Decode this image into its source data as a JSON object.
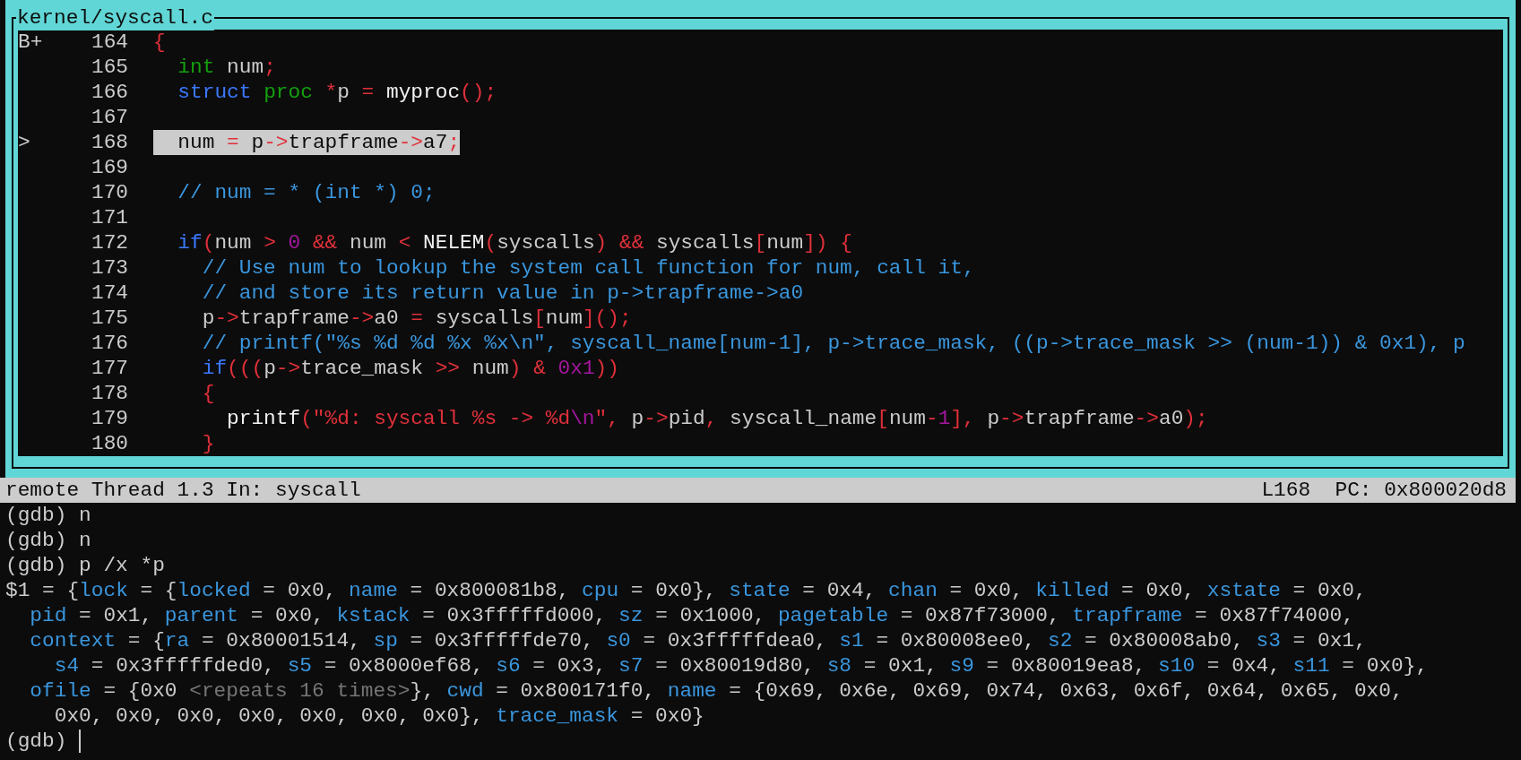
{
  "source_window": {
    "title": "kernel/syscall.c",
    "lines": [
      {
        "marker": "B+",
        "number": "164",
        "current": false,
        "tokens": [
          {
            "kind": "op",
            "text": "{"
          }
        ]
      },
      {
        "number": "165",
        "current": false,
        "tokens": [
          {
            "kind": "type",
            "text": "  int"
          },
          {
            "kind": "plain",
            "text": " num"
          },
          {
            "kind": "op",
            "text": ";"
          }
        ]
      },
      {
        "number": "166",
        "current": false,
        "tokens": [
          {
            "kind": "keyword",
            "text": "  struct"
          },
          {
            "kind": "type",
            "text": " proc"
          },
          {
            "kind": "op",
            "text": " *"
          },
          {
            "kind": "plain",
            "text": "p "
          },
          {
            "kind": "op",
            "text": "="
          },
          {
            "kind": "func",
            "text": " myproc"
          },
          {
            "kind": "op",
            "text": "();"
          }
        ]
      },
      {
        "number": "167",
        "current": false
      },
      {
        "marker": ">",
        "number": "168",
        "current": true,
        "tokens": [
          {
            "kind": "plain",
            "text": "  num "
          },
          {
            "kind": "op",
            "text": "="
          },
          {
            "kind": "plain",
            "text": " p"
          },
          {
            "kind": "op",
            "text": "->"
          },
          {
            "kind": "plain",
            "text": "trapframe"
          },
          {
            "kind": "op",
            "text": "->"
          },
          {
            "kind": "plain",
            "text": "a7"
          },
          {
            "kind": "op",
            "text": ";"
          }
        ]
      },
      {
        "number": "169",
        "current": false
      },
      {
        "number": "170",
        "current": false,
        "tokens": [
          {
            "kind": "comment",
            "text": "  // num = * (int *) 0;"
          }
        ]
      },
      {
        "number": "171",
        "current": false
      },
      {
        "number": "172",
        "current": false,
        "tokens": [
          {
            "kind": "keyword",
            "text": "  if"
          },
          {
            "kind": "op",
            "text": "("
          },
          {
            "kind": "plain",
            "text": "num "
          },
          {
            "kind": "op",
            "text": ">"
          },
          {
            "kind": "number",
            "text": " 0"
          },
          {
            "kind": "op",
            "text": " &&"
          },
          {
            "kind": "plain",
            "text": " num "
          },
          {
            "kind": "op",
            "text": "<"
          },
          {
            "kind": "func",
            "text": " NELEM"
          },
          {
            "kind": "op",
            "text": "("
          },
          {
            "kind": "plain",
            "text": "syscalls"
          },
          {
            "kind": "op",
            "text": ")"
          },
          {
            "kind": "op",
            "text": " &&"
          },
          {
            "kind": "plain",
            "text": " syscalls"
          },
          {
            "kind": "op",
            "text": "["
          },
          {
            "kind": "plain",
            "text": "num"
          },
          {
            "kind": "op",
            "text": "])"
          },
          {
            "kind": "op",
            "text": " {"
          }
        ]
      },
      {
        "number": "173",
        "current": false,
        "tokens": [
          {
            "kind": "comment",
            "text": "    // Use num to lookup the system call function for num, call it,"
          }
        ]
      },
      {
        "number": "174",
        "current": false,
        "tokens": [
          {
            "kind": "comment",
            "text": "    // and store its return value in p->trapframe->a0"
          }
        ]
      },
      {
        "number": "175",
        "current": false,
        "tokens": [
          {
            "kind": "plain",
            "text": "    p"
          },
          {
            "kind": "op",
            "text": "->"
          },
          {
            "kind": "plain",
            "text": "trapframe"
          },
          {
            "kind": "op",
            "text": "->"
          },
          {
            "kind": "plain",
            "text": "a0 "
          },
          {
            "kind": "op",
            "text": "="
          },
          {
            "kind": "plain",
            "text": " syscalls"
          },
          {
            "kind": "op",
            "text": "["
          },
          {
            "kind": "plain",
            "text": "num"
          },
          {
            "kind": "op",
            "text": "]();"
          }
        ]
      },
      {
        "number": "176",
        "current": false,
        "tokens": [
          {
            "kind": "comment",
            "text": "    // printf(\"%s %d %d %x %x\\n\", syscall_name[num-1], p->trace_mask, ((p->trace_mask >> (num-1)) & 0x1), p"
          }
        ]
      },
      {
        "number": "177",
        "current": false,
        "tokens": [
          {
            "kind": "keyword",
            "text": "    if"
          },
          {
            "kind": "op",
            "text": "((("
          },
          {
            "kind": "plain",
            "text": "p"
          },
          {
            "kind": "op",
            "text": "->"
          },
          {
            "kind": "plain",
            "text": "trace_mask "
          },
          {
            "kind": "op",
            "text": ">>"
          },
          {
            "kind": "plain",
            "text": " num"
          },
          {
            "kind": "op",
            "text": ")"
          },
          {
            "kind": "op",
            "text": " &"
          },
          {
            "kind": "number",
            "text": " 0x1"
          },
          {
            "kind": "op",
            "text": "))"
          }
        ]
      },
      {
        "number": "178",
        "current": false,
        "tokens": [
          {
            "kind": "op",
            "text": "    {"
          }
        ]
      },
      {
        "number": "179",
        "current": false,
        "tokens": [
          {
            "kind": "func",
            "text": "      printf"
          },
          {
            "kind": "op",
            "text": "("
          },
          {
            "kind": "string",
            "text": "\"%d: syscall %s -> %d"
          },
          {
            "kind": "number",
            "text": "\\n"
          },
          {
            "kind": "string",
            "text": "\""
          },
          {
            "kind": "op",
            "text": ","
          },
          {
            "kind": "plain",
            "text": " p"
          },
          {
            "kind": "op",
            "text": "->"
          },
          {
            "kind": "plain",
            "text": "pid"
          },
          {
            "kind": "op",
            "text": ","
          },
          {
            "kind": "plain",
            "text": " syscall_name"
          },
          {
            "kind": "op",
            "text": "["
          },
          {
            "kind": "plain",
            "text": "num"
          },
          {
            "kind": "op",
            "text": "-"
          },
          {
            "kind": "number",
            "text": "1"
          },
          {
            "kind": "op",
            "text": "],"
          },
          {
            "kind": "plain",
            "text": " p"
          },
          {
            "kind": "op",
            "text": "->"
          },
          {
            "kind": "plain",
            "text": "trapframe"
          },
          {
            "kind": "op",
            "text": "->"
          },
          {
            "kind": "plain",
            "text": "a0"
          },
          {
            "kind": "op",
            "text": ");"
          }
        ]
      },
      {
        "number": "180",
        "current": false,
        "tokens": [
          {
            "kind": "op",
            "text": "    }"
          }
        ]
      }
    ]
  },
  "status_bar": {
    "left": "remote Thread 1.3 In: syscall",
    "right": "L168  PC: 0x800020d8"
  },
  "console": {
    "lines": [
      [
        {
          "kind": "plain",
          "text": "(gdb) n"
        }
      ],
      [
        {
          "kind": "plain",
          "text": "(gdb) n"
        }
      ],
      [
        {
          "kind": "plain",
          "text": "(gdb) p /x *p"
        }
      ],
      [
        {
          "kind": "plain",
          "text": "$1 = {"
        },
        {
          "kind": "field",
          "text": "lock"
        },
        {
          "kind": "plain",
          "text": " = {"
        },
        {
          "kind": "field",
          "text": "locked"
        },
        {
          "kind": "plain",
          "text": " = 0x0, "
        },
        {
          "kind": "field",
          "text": "name"
        },
        {
          "kind": "plain",
          "text": " = 0x800081b8, "
        },
        {
          "kind": "field",
          "text": "cpu"
        },
        {
          "kind": "plain",
          "text": " = 0x0}, "
        },
        {
          "kind": "field",
          "text": "state"
        },
        {
          "kind": "plain",
          "text": " = 0x4, "
        },
        {
          "kind": "field",
          "text": "chan"
        },
        {
          "kind": "plain",
          "text": " = 0x0, "
        },
        {
          "kind": "field",
          "text": "killed"
        },
        {
          "kind": "plain",
          "text": " = 0x0, "
        },
        {
          "kind": "field",
          "text": "xstate"
        },
        {
          "kind": "plain",
          "text": " = 0x0,"
        }
      ],
      [
        {
          "kind": "field",
          "text": "  pid"
        },
        {
          "kind": "plain",
          "text": " = 0x1, "
        },
        {
          "kind": "field",
          "text": "parent"
        },
        {
          "kind": "plain",
          "text": " = 0x0, "
        },
        {
          "kind": "field",
          "text": "kstack"
        },
        {
          "kind": "plain",
          "text": " = 0x3fffffd000, "
        },
        {
          "kind": "field",
          "text": "sz"
        },
        {
          "kind": "plain",
          "text": " = 0x1000, "
        },
        {
          "kind": "field",
          "text": "pagetable"
        },
        {
          "kind": "plain",
          "text": " = 0x87f73000, "
        },
        {
          "kind": "field",
          "text": "trapframe"
        },
        {
          "kind": "plain",
          "text": " = 0x87f74000,"
        }
      ],
      [
        {
          "kind": "field",
          "text": "  context"
        },
        {
          "kind": "plain",
          "text": " = {"
        },
        {
          "kind": "field",
          "text": "ra"
        },
        {
          "kind": "plain",
          "text": " = 0x80001514, "
        },
        {
          "kind": "field",
          "text": "sp"
        },
        {
          "kind": "plain",
          "text": " = 0x3fffffde70, "
        },
        {
          "kind": "field",
          "text": "s0"
        },
        {
          "kind": "plain",
          "text": " = 0x3fffffdea0, "
        },
        {
          "kind": "field",
          "text": "s1"
        },
        {
          "kind": "plain",
          "text": " = 0x80008ee0, "
        },
        {
          "kind": "field",
          "text": "s2"
        },
        {
          "kind": "plain",
          "text": " = 0x80008ab0, "
        },
        {
          "kind": "field",
          "text": "s3"
        },
        {
          "kind": "plain",
          "text": " = 0x1,"
        }
      ],
      [
        {
          "kind": "field",
          "text": "    s4"
        },
        {
          "kind": "plain",
          "text": " = 0x3fffffded0, "
        },
        {
          "kind": "field",
          "text": "s5"
        },
        {
          "kind": "plain",
          "text": " = 0x8000ef68, "
        },
        {
          "kind": "field",
          "text": "s6"
        },
        {
          "kind": "plain",
          "text": " = 0x3, "
        },
        {
          "kind": "field",
          "text": "s7"
        },
        {
          "kind": "plain",
          "text": " = 0x80019d80, "
        },
        {
          "kind": "field",
          "text": "s8"
        },
        {
          "kind": "plain",
          "text": " = 0x1, "
        },
        {
          "kind": "field",
          "text": "s9"
        },
        {
          "kind": "plain",
          "text": " = 0x80019ea8, "
        },
        {
          "kind": "field",
          "text": "s10"
        },
        {
          "kind": "plain",
          "text": " = 0x4, "
        },
        {
          "kind": "field",
          "text": "s11"
        },
        {
          "kind": "plain",
          "text": " = 0x0},"
        }
      ],
      [
        {
          "kind": "field",
          "text": "  ofile"
        },
        {
          "kind": "plain",
          "text": " = {0x0 "
        },
        {
          "kind": "dim",
          "text": "<repeats 16 times>"
        },
        {
          "kind": "plain",
          "text": "}, "
        },
        {
          "kind": "field",
          "text": "cwd"
        },
        {
          "kind": "plain",
          "text": " = 0x800171f0, "
        },
        {
          "kind": "field",
          "text": "name"
        },
        {
          "kind": "plain",
          "text": " = {0x69, 0x6e, 0x69, 0x74, 0x63, 0x6f, 0x64, 0x65, 0x0,"
        }
      ],
      [
        {
          "kind": "plain",
          "text": "    0x0, 0x0, 0x0, 0x0, 0x0, 0x0, 0x0}, "
        },
        {
          "kind": "field",
          "text": "trace_mask"
        },
        {
          "kind": "plain",
          "text": " = 0x0}"
        }
      ]
    ],
    "prompt": "(gdb)"
  }
}
